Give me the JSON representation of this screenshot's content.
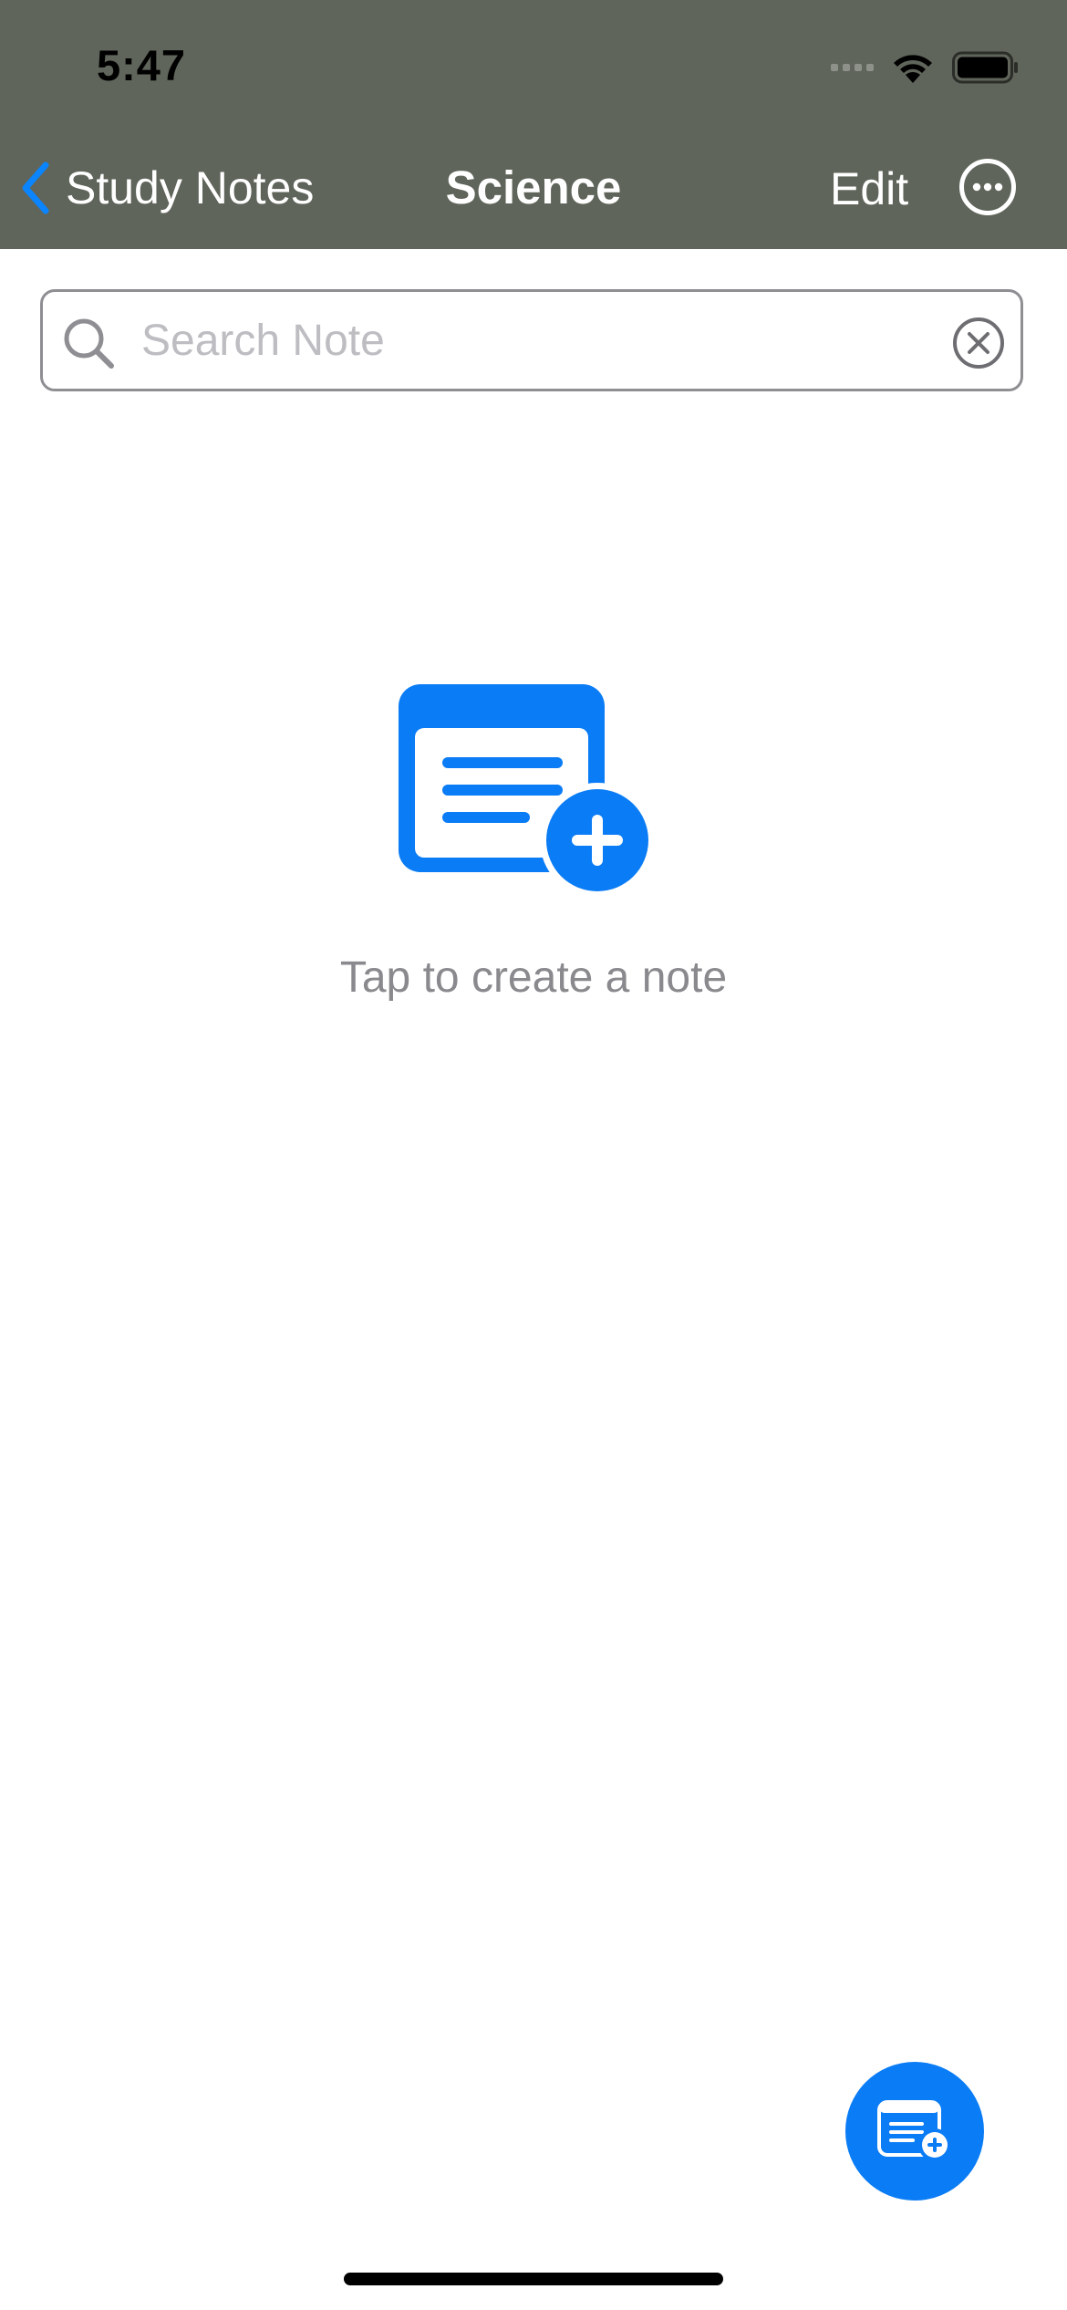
{
  "status_bar": {
    "time": "5:47"
  },
  "nav": {
    "back_label": "Study Notes",
    "title": "Science",
    "edit_label": "Edit"
  },
  "search": {
    "placeholder": "Search Note",
    "value": ""
  },
  "empty_state": {
    "message": "Tap to create a note"
  },
  "icons": {
    "back": "chevron-left-icon",
    "more": "ellipsis-circle-icon",
    "search": "magnifying-glass-icon",
    "clear": "xmark-circle-icon",
    "create_note": "note-add-icon",
    "fab": "note-add-icon"
  },
  "colors": {
    "header_bg": "#5f655a",
    "accent": "#0a7cf5",
    "placeholder": "#bdbdc2",
    "empty_text": "#8a8a8e"
  }
}
